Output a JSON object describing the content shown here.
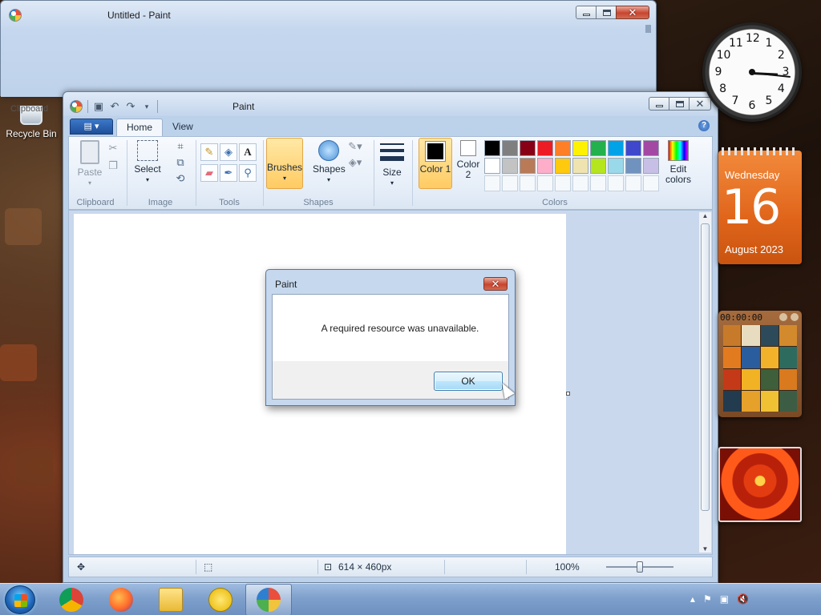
{
  "back_window": {
    "title": "Untitled - Paint",
    "clipboard_label": "Clipboard"
  },
  "desktop": {
    "recycle_bin_label": "Recycle Bin"
  },
  "paint": {
    "title": "Paint",
    "tabs": [
      {
        "label": "Home",
        "active": true
      },
      {
        "label": "View",
        "active": false
      }
    ],
    "ribbon": {
      "clipboard": {
        "paste": "Paste",
        "group": "Clipboard"
      },
      "image": {
        "select": "Select",
        "group": "Image"
      },
      "tools": {
        "group": "Tools"
      },
      "shapes": {
        "brushes": "Brushes",
        "shapes": "Shapes",
        "group": "Shapes"
      },
      "size": {
        "label": "Size"
      },
      "colors": {
        "color1": "Color 1",
        "color2": "Color 2",
        "edit": "Edit colors",
        "group": "Colors",
        "row1": [
          "#000000",
          "#7f7f7f",
          "#880015",
          "#ed1c24",
          "#ff7f27",
          "#fff200",
          "#22b14c",
          "#00a2e8",
          "#3f48cc",
          "#a349a4"
        ],
        "row2": [
          "#ffffff",
          "#c3c3c3",
          "#b97a57",
          "#ffaec9",
          "#ffc90e",
          "#efe4b0",
          "#b5e61d",
          "#99d9ea",
          "#7092be",
          "#c8bfe7"
        ]
      }
    },
    "status": {
      "dimensions": "614 × 460px",
      "zoom": "100%"
    }
  },
  "dialog": {
    "title": "Paint",
    "message": "A required resource was unavailable.",
    "ok": "OK"
  },
  "gadgets": {
    "clock_numbers": [
      "12",
      "1",
      "2",
      "3",
      "4",
      "5",
      "6",
      "7",
      "8",
      "9",
      "10",
      "11"
    ],
    "calendar": {
      "weekday": "Wednesday",
      "day": "16",
      "month_year": "August 2023"
    },
    "puzzle_timer": "00:00:00"
  },
  "taskbar": {
    "apps": [
      "chrome-icon",
      "firefox-icon",
      "explorer-icon",
      "chat-icon",
      "paint-icon"
    ],
    "active_app": "paint-icon"
  }
}
